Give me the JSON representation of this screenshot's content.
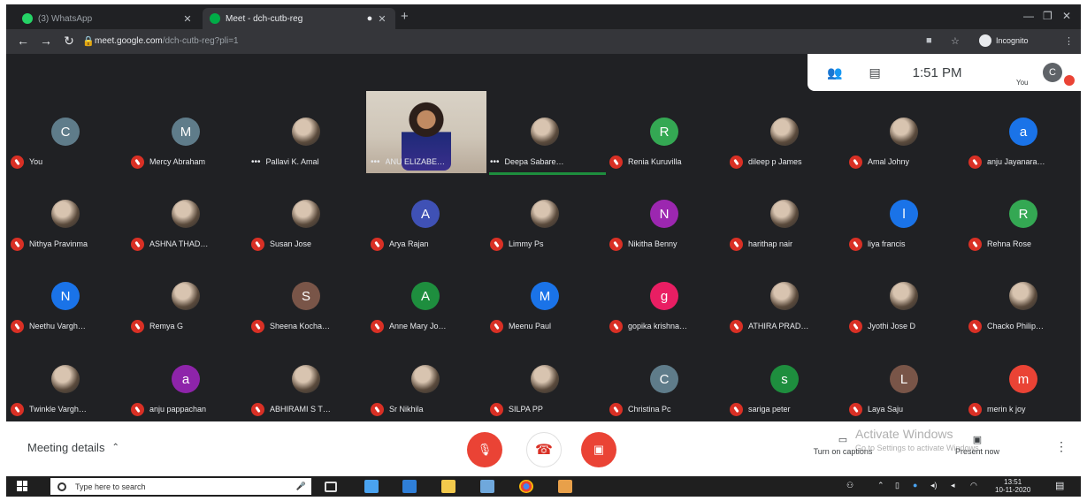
{
  "browser": {
    "tabs": [
      {
        "label": "(3) WhatsApp",
        "color": "#25d366"
      },
      {
        "label": "Meet - dch-cutb-reg",
        "color": "#00ac47"
      }
    ],
    "url": {
      "host": "meet.google.com",
      "path": "/dch-cutb-reg?pli=1"
    },
    "profile": "Incognito"
  },
  "meet_header": {
    "time": "1:51 PM",
    "self_label": "You",
    "self_initial": "C"
  },
  "participants": [
    {
      "name": "You",
      "initial": "C",
      "color": "#5f7c8a",
      "dots": false
    },
    {
      "name": "Mercy Abraham",
      "initial": "M",
      "color": "#5f7c8a",
      "dots": false
    },
    {
      "name": "Pallavi K. Amal",
      "initial": "",
      "color": "",
      "dots": true
    },
    {
      "name": "ANU ELIZABE…",
      "initial": "",
      "color": "",
      "dots": true,
      "video": true
    },
    {
      "name": "Deepa Sabare…",
      "initial": "",
      "color": "",
      "dots": true
    },
    {
      "name": "Renia Kuruvilla",
      "initial": "R",
      "color": "#34a853",
      "dots": false
    },
    {
      "name": "dileep p James",
      "initial": "",
      "color": "",
      "dots": false
    },
    {
      "name": "Amal Johny",
      "initial": "",
      "color": "",
      "dots": false
    },
    {
      "name": "anju Jayanara…",
      "initial": "a",
      "color": "#1a73e8",
      "dots": false
    },
    {
      "name": "Nithya Pravinma",
      "initial": "",
      "color": "",
      "dots": false
    },
    {
      "name": "ASHNA THAD…",
      "initial": "",
      "color": "",
      "dots": false
    },
    {
      "name": "Susan Jose",
      "initial": "",
      "color": "",
      "dots": false
    },
    {
      "name": "Arya Rajan",
      "initial": "A",
      "color": "#3f51b5",
      "dots": false
    },
    {
      "name": "Limmy Ps",
      "initial": "",
      "color": "",
      "dots": false
    },
    {
      "name": "Nikitha Benny",
      "initial": "N",
      "color": "#9c27b0",
      "dots": false
    },
    {
      "name": "harithap nair",
      "initial": "",
      "color": "",
      "dots": false
    },
    {
      "name": "liya francis",
      "initial": "l",
      "color": "#1a73e8",
      "dots": false
    },
    {
      "name": "Rehna Rose",
      "initial": "R",
      "color": "#34a853",
      "dots": false
    },
    {
      "name": "Neethu Vargh…",
      "initial": "N",
      "color": "#1a73e8",
      "dots": false
    },
    {
      "name": "Remya G",
      "initial": "",
      "color": "",
      "dots": false
    },
    {
      "name": "Sheena Kocha…",
      "initial": "S",
      "color": "#795548",
      "dots": false
    },
    {
      "name": "Anne Mary Jo…",
      "initial": "A",
      "color": "#1e8e3e",
      "dots": false
    },
    {
      "name": "Meenu Paul",
      "initial": "M",
      "color": "#1a73e8",
      "dots": false
    },
    {
      "name": "gopika krishna…",
      "initial": "g",
      "color": "#e91e63",
      "dots": false
    },
    {
      "name": "ATHIRA PRAD…",
      "initial": "",
      "color": "",
      "dots": false
    },
    {
      "name": "Jyothi Jose D",
      "initial": "",
      "color": "",
      "dots": false
    },
    {
      "name": "Chacko Philip…",
      "initial": "",
      "color": "",
      "dots": false
    },
    {
      "name": "Twinkle Vargh…",
      "initial": "",
      "color": "",
      "dots": false
    },
    {
      "name": "anju pappachan",
      "initial": "a",
      "color": "#8e24aa",
      "dots": false
    },
    {
      "name": "ABHIRAMI S T…",
      "initial": "",
      "color": "",
      "dots": false
    },
    {
      "name": "Sr Nikhila",
      "initial": "",
      "color": "",
      "dots": false
    },
    {
      "name": "SILPA PP",
      "initial": "",
      "color": "",
      "dots": false
    },
    {
      "name": "Christina Pc",
      "initial": "C",
      "color": "#5f7c8a",
      "dots": false
    },
    {
      "name": "sariga peter",
      "initial": "s",
      "color": "#1e8e3e",
      "dots": false
    },
    {
      "name": "Laya Saju",
      "initial": "L",
      "color": "#795548",
      "dots": false
    },
    {
      "name": "merin k joy",
      "initial": "m",
      "color": "#ea4335",
      "dots": false
    }
  ],
  "controls": {
    "meeting_details": "Meeting details",
    "turn_on_captions": "Turn on captions",
    "present_now": "Present now"
  },
  "watermark": {
    "title": "Activate Windows",
    "subtitle": "Go to Settings to activate Windows."
  },
  "taskbar": {
    "search_placeholder": "Type here to search",
    "time": "13:51",
    "date": "10-11-2020"
  }
}
